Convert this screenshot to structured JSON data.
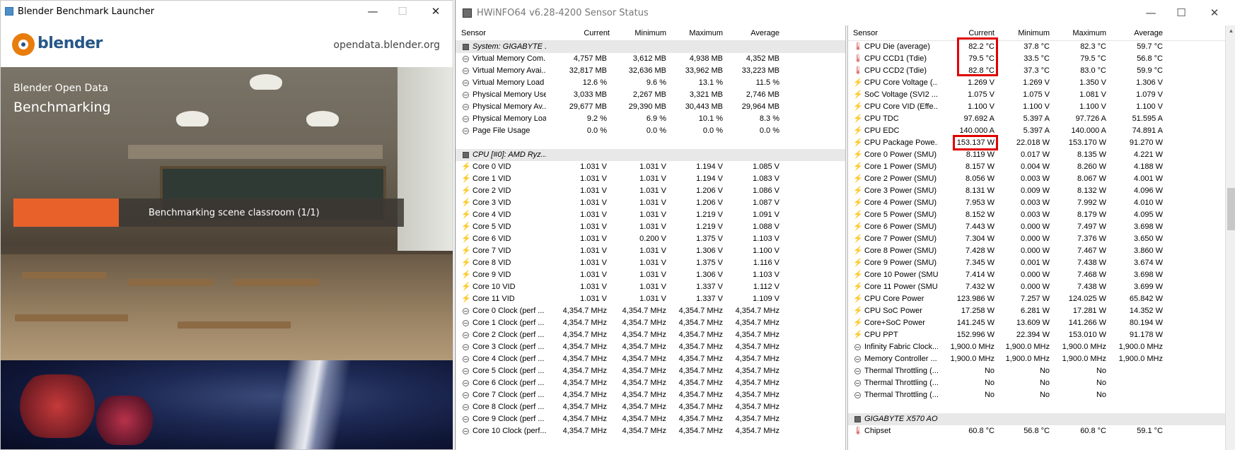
{
  "blender": {
    "window_title": "Blender Benchmark Launcher",
    "logo_text": "blender",
    "url": "opendata.blender.org",
    "subtitle": "Blender Open Data",
    "title": "Benchmarking",
    "status": "Benchmarking scene classroom (1/1)",
    "progress_fraction": 0.27
  },
  "hwinfo": {
    "window_title": "HWiNFO64 v6.28-4200 Sensor Status",
    "columns": [
      "Sensor",
      "Current",
      "Minimum",
      "Maximum",
      "Average"
    ],
    "left_rows": [
      {
        "type": "group",
        "icon": "chip",
        "name": "System: GIGABYTE ..."
      },
      {
        "icon": "circle",
        "name": "Virtual Memory Com...",
        "cur": "4,757 MB",
        "min": "3,612 MB",
        "max": "4,938 MB",
        "avg": "4,352 MB"
      },
      {
        "icon": "circle",
        "name": "Virtual Memory Avai...",
        "cur": "32,817 MB",
        "min": "32,636 MB",
        "max": "33,962 MB",
        "avg": "33,223 MB"
      },
      {
        "icon": "circle",
        "name": "Virtual Memory Load",
        "cur": "12.6 %",
        "min": "9.6 %",
        "max": "13.1 %",
        "avg": "11.5 %"
      },
      {
        "icon": "circle",
        "name": "Physical Memory Used",
        "cur": "3,033 MB",
        "min": "2,267 MB",
        "max": "3,321 MB",
        "avg": "2,746 MB"
      },
      {
        "icon": "circle",
        "name": "Physical Memory Av...",
        "cur": "29,677 MB",
        "min": "29,390 MB",
        "max": "30,443 MB",
        "avg": "29,964 MB"
      },
      {
        "icon": "circle",
        "name": "Physical Memory Load",
        "cur": "9.2 %",
        "min": "6.9 %",
        "max": "10.1 %",
        "avg": "8.3 %"
      },
      {
        "icon": "circle",
        "name": "Page File Usage",
        "cur": "0.0 %",
        "min": "0.0 %",
        "max": "0.0 %",
        "avg": "0.0 %"
      },
      {
        "type": "blank"
      },
      {
        "type": "group",
        "icon": "chip",
        "name": "CPU [#0]: AMD Ryz..."
      },
      {
        "icon": "bolt",
        "name": "Core 0 VID",
        "cur": "1.031 V",
        "min": "1.031 V",
        "max": "1.194 V",
        "avg": "1.085 V"
      },
      {
        "icon": "bolt",
        "name": "Core 1 VID",
        "cur": "1.031 V",
        "min": "1.031 V",
        "max": "1.194 V",
        "avg": "1.083 V"
      },
      {
        "icon": "bolt",
        "name": "Core 2 VID",
        "cur": "1.031 V",
        "min": "1.031 V",
        "max": "1.206 V",
        "avg": "1.086 V"
      },
      {
        "icon": "bolt",
        "name": "Core 3 VID",
        "cur": "1.031 V",
        "min": "1.031 V",
        "max": "1.206 V",
        "avg": "1.087 V"
      },
      {
        "icon": "bolt",
        "name": "Core 4 VID",
        "cur": "1.031 V",
        "min": "1.031 V",
        "max": "1.219 V",
        "avg": "1.091 V"
      },
      {
        "icon": "bolt",
        "name": "Core 5 VID",
        "cur": "1.031 V",
        "min": "1.031 V",
        "max": "1.219 V",
        "avg": "1.088 V"
      },
      {
        "icon": "bolt",
        "name": "Core 6 VID",
        "cur": "1.031 V",
        "min": "0.200 V",
        "max": "1.375 V",
        "avg": "1.103 V"
      },
      {
        "icon": "bolt",
        "name": "Core 7 VID",
        "cur": "1.031 V",
        "min": "1.031 V",
        "max": "1.306 V",
        "avg": "1.100 V"
      },
      {
        "icon": "bolt",
        "name": "Core 8 VID",
        "cur": "1.031 V",
        "min": "1.031 V",
        "max": "1.375 V",
        "avg": "1.116 V"
      },
      {
        "icon": "bolt",
        "name": "Core 9 VID",
        "cur": "1.031 V",
        "min": "1.031 V",
        "max": "1.306 V",
        "avg": "1.103 V"
      },
      {
        "icon": "bolt",
        "name": "Core 10 VID",
        "cur": "1.031 V",
        "min": "1.031 V",
        "max": "1.337 V",
        "avg": "1.112 V"
      },
      {
        "icon": "bolt",
        "name": "Core 11 VID",
        "cur": "1.031 V",
        "min": "1.031 V",
        "max": "1.337 V",
        "avg": "1.109 V"
      },
      {
        "icon": "circle",
        "name": "Core 0 Clock (perf ...",
        "cur": "4,354.7 MHz",
        "min": "4,354.7 MHz",
        "max": "4,354.7 MHz",
        "avg": "4,354.7 MHz"
      },
      {
        "icon": "circle",
        "name": "Core 1 Clock (perf ...",
        "cur": "4,354.7 MHz",
        "min": "4,354.7 MHz",
        "max": "4,354.7 MHz",
        "avg": "4,354.7 MHz"
      },
      {
        "icon": "circle",
        "name": "Core 2 Clock (perf ...",
        "cur": "4,354.7 MHz",
        "min": "4,354.7 MHz",
        "max": "4,354.7 MHz",
        "avg": "4,354.7 MHz"
      },
      {
        "icon": "circle",
        "name": "Core 3 Clock (perf ...",
        "cur": "4,354.7 MHz",
        "min": "4,354.7 MHz",
        "max": "4,354.7 MHz",
        "avg": "4,354.7 MHz"
      },
      {
        "icon": "circle",
        "name": "Core 4 Clock (perf ...",
        "cur": "4,354.7 MHz",
        "min": "4,354.7 MHz",
        "max": "4,354.7 MHz",
        "avg": "4,354.7 MHz"
      },
      {
        "icon": "circle",
        "name": "Core 5 Clock (perf ...",
        "cur": "4,354.7 MHz",
        "min": "4,354.7 MHz",
        "max": "4,354.7 MHz",
        "avg": "4,354.7 MHz"
      },
      {
        "icon": "circle",
        "name": "Core 6 Clock (perf ...",
        "cur": "4,354.7 MHz",
        "min": "4,354.7 MHz",
        "max": "4,354.7 MHz",
        "avg": "4,354.7 MHz"
      },
      {
        "icon": "circle",
        "name": "Core 7 Clock (perf ...",
        "cur": "4,354.7 MHz",
        "min": "4,354.7 MHz",
        "max": "4,354.7 MHz",
        "avg": "4,354.7 MHz"
      },
      {
        "icon": "circle",
        "name": "Core 8 Clock (perf ...",
        "cur": "4,354.7 MHz",
        "min": "4,354.7 MHz",
        "max": "4,354.7 MHz",
        "avg": "4,354.7 MHz"
      },
      {
        "icon": "circle",
        "name": "Core 9 Clock (perf ...",
        "cur": "4,354.7 MHz",
        "min": "4,354.7 MHz",
        "max": "4,354.7 MHz",
        "avg": "4,354.7 MHz"
      },
      {
        "icon": "circle",
        "name": "Core 10 Clock (perf...",
        "cur": "4,354.7 MHz",
        "min": "4,354.7 MHz",
        "max": "4,354.7 MHz",
        "avg": "4,354.7 MHz"
      }
    ],
    "right_rows": [
      {
        "icon": "therm",
        "name": "CPU Die (average)",
        "cur": "82.2 °C",
        "min": "37.8 °C",
        "max": "82.3 °C",
        "avg": "59.7 °C"
      },
      {
        "icon": "therm",
        "name": "CPU CCD1 (Tdie)",
        "cur": "79.5 °C",
        "min": "33.5 °C",
        "max": "79.5 °C",
        "avg": "56.8 °C"
      },
      {
        "icon": "therm",
        "name": "CPU CCD2 (Tdie)",
        "cur": "82.8 °C",
        "min": "37.3 °C",
        "max": "83.0 °C",
        "avg": "59.9 °C"
      },
      {
        "icon": "bolt",
        "name": "CPU Core Voltage (...",
        "cur": "1.269 V",
        "min": "1.269 V",
        "max": "1.350 V",
        "avg": "1.306 V"
      },
      {
        "icon": "bolt",
        "name": "SoC Voltage (SVI2 ...",
        "cur": "1.075 V",
        "min": "1.075 V",
        "max": "1.081 V",
        "avg": "1.079 V"
      },
      {
        "icon": "bolt",
        "name": "CPU Core VID (Effe...",
        "cur": "1.100 V",
        "min": "1.100 V",
        "max": "1.100 V",
        "avg": "1.100 V"
      },
      {
        "icon": "bolt",
        "name": "CPU TDC",
        "cur": "97.692 A",
        "min": "5.397 A",
        "max": "97.726 A",
        "avg": "51.595 A"
      },
      {
        "icon": "bolt",
        "name": "CPU EDC",
        "cur": "140.000 A",
        "min": "5.397 A",
        "max": "140.000 A",
        "avg": "74.891 A"
      },
      {
        "icon": "bolt",
        "name": "CPU Package Powe...",
        "cur": "153.137 W",
        "min": "22.018 W",
        "max": "153.170 W",
        "avg": "91.270 W"
      },
      {
        "icon": "bolt",
        "name": "Core 0 Power (SMU)",
        "cur": "8.119 W",
        "min": "0.017 W",
        "max": "8.135 W",
        "avg": "4.221 W"
      },
      {
        "icon": "bolt",
        "name": "Core 1 Power (SMU)",
        "cur": "8.157 W",
        "min": "0.004 W",
        "max": "8.260 W",
        "avg": "4.188 W"
      },
      {
        "icon": "bolt",
        "name": "Core 2 Power (SMU)",
        "cur": "8.056 W",
        "min": "0.003 W",
        "max": "8.067 W",
        "avg": "4.001 W"
      },
      {
        "icon": "bolt",
        "name": "Core 3 Power (SMU)",
        "cur": "8.131 W",
        "min": "0.009 W",
        "max": "8.132 W",
        "avg": "4.096 W"
      },
      {
        "icon": "bolt",
        "name": "Core 4 Power (SMU)",
        "cur": "7.953 W",
        "min": "0.003 W",
        "max": "7.992 W",
        "avg": "4.010 W"
      },
      {
        "icon": "bolt",
        "name": "Core 5 Power (SMU)",
        "cur": "8.152 W",
        "min": "0.003 W",
        "max": "8.179 W",
        "avg": "4.095 W"
      },
      {
        "icon": "bolt",
        "name": "Core 6 Power (SMU)",
        "cur": "7.443 W",
        "min": "0.000 W",
        "max": "7.497 W",
        "avg": "3.698 W"
      },
      {
        "icon": "bolt",
        "name": "Core 7 Power (SMU)",
        "cur": "7.304 W",
        "min": "0.000 W",
        "max": "7.376 W",
        "avg": "3.650 W"
      },
      {
        "icon": "bolt",
        "name": "Core 8 Power (SMU)",
        "cur": "7.428 W",
        "min": "0.000 W",
        "max": "7.467 W",
        "avg": "3.860 W"
      },
      {
        "icon": "bolt",
        "name": "Core 9 Power (SMU)",
        "cur": "7.345 W",
        "min": "0.001 W",
        "max": "7.438 W",
        "avg": "3.674 W"
      },
      {
        "icon": "bolt",
        "name": "Core 10 Power (SMU)",
        "cur": "7.414 W",
        "min": "0.000 W",
        "max": "7.468 W",
        "avg": "3.698 W"
      },
      {
        "icon": "bolt",
        "name": "Core 11 Power (SMU)",
        "cur": "7.432 W",
        "min": "0.000 W",
        "max": "7.438 W",
        "avg": "3.699 W"
      },
      {
        "icon": "bolt",
        "name": "CPU Core Power",
        "cur": "123.986 W",
        "min": "7.257 W",
        "max": "124.025 W",
        "avg": "65.842 W"
      },
      {
        "icon": "bolt",
        "name": "CPU SoC Power",
        "cur": "17.258 W",
        "min": "6.281 W",
        "max": "17.281 W",
        "avg": "14.352 W"
      },
      {
        "icon": "bolt",
        "name": "Core+SoC Power",
        "cur": "141.245 W",
        "min": "13.609 W",
        "max": "141.266 W",
        "avg": "80.194 W"
      },
      {
        "icon": "bolt",
        "name": "CPU PPT",
        "cur": "152.996 W",
        "min": "22.394 W",
        "max": "153.010 W",
        "avg": "91.178 W"
      },
      {
        "icon": "circle",
        "name": "Infinity Fabric Clock...",
        "cur": "1,900.0 MHz",
        "min": "1,900.0 MHz",
        "max": "1,900.0 MHz",
        "avg": "1,900.0 MHz"
      },
      {
        "icon": "circle",
        "name": "Memory Controller ...",
        "cur": "1,900.0 MHz",
        "min": "1,900.0 MHz",
        "max": "1,900.0 MHz",
        "avg": "1,900.0 MHz"
      },
      {
        "icon": "circle",
        "name": "Thermal Throttling (...",
        "cur": "No",
        "min": "No",
        "max": "No",
        "avg": ""
      },
      {
        "icon": "circle",
        "name": "Thermal Throttling (...",
        "cur": "No",
        "min": "No",
        "max": "No",
        "avg": ""
      },
      {
        "icon": "circle",
        "name": "Thermal Throttling (...",
        "cur": "No",
        "min": "No",
        "max": "No",
        "avg": ""
      },
      {
        "type": "blank"
      },
      {
        "type": "group",
        "icon": "chip",
        "name": "GIGABYTE X570 AO..."
      },
      {
        "icon": "therm",
        "name": "Chipset",
        "cur": "60.8 °C",
        "min": "56.8 °C",
        "max": "60.8 °C",
        "avg": "59.1 °C"
      }
    ]
  }
}
